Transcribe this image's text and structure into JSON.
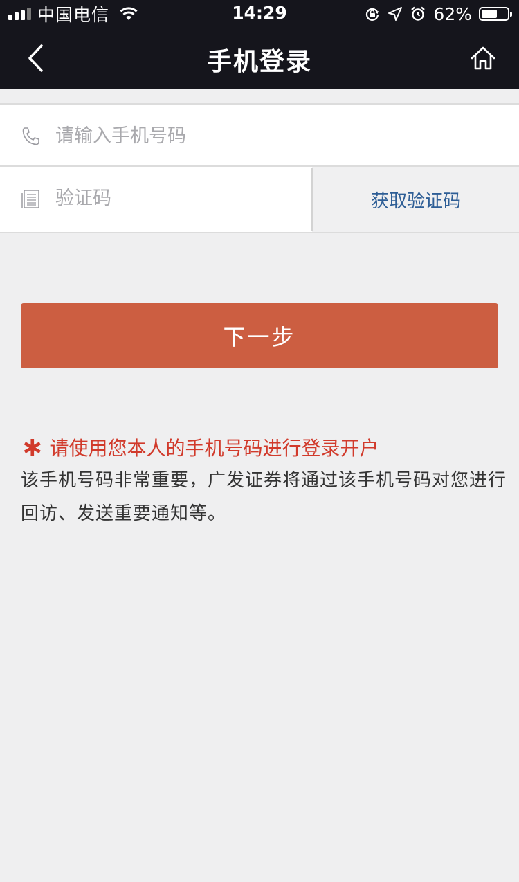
{
  "status_bar": {
    "carrier": "中国电信",
    "time": "14:29",
    "battery": "62%",
    "battery_level": 0.62,
    "icons": [
      "signal-icon",
      "wifi-icon",
      "rotation-lock-icon",
      "location-icon",
      "alarm-icon",
      "battery-icon"
    ]
  },
  "nav": {
    "title": "手机登录",
    "back_icon": "back-chevron-icon",
    "home_icon": "home-icon"
  },
  "form": {
    "phone": {
      "value": "",
      "placeholder": "请输入手机号码",
      "icon": "phone-icon"
    },
    "code": {
      "value": "",
      "placeholder": "验证码",
      "icon": "document-icon"
    },
    "get_code_label": "获取验证码"
  },
  "next_label": "下一步",
  "notice": {
    "asterisk": "∗",
    "title": "请使用您本人的手机号码进行登录开户",
    "body": "该手机号码非常重要，广发证券将通过该手机号码对您进行回访、发送重要通知等。"
  },
  "colors": {
    "header_bg": "#15151c",
    "primary_button": "#cc5e41",
    "link": "#2e5e96",
    "warning": "#d13a2b",
    "page_bg": "#efeff0"
  }
}
